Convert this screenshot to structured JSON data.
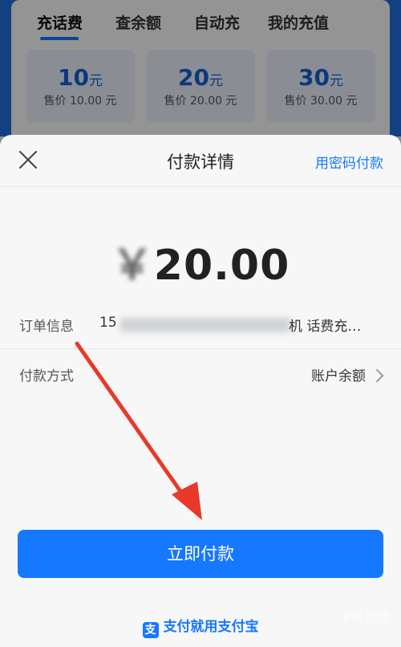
{
  "background": {
    "tabs": [
      "充话费",
      "查余额",
      "自动充",
      "我的充值"
    ],
    "prices": [
      {
        "amount": "10",
        "unit": "元",
        "sale": "售价 10.00 元"
      },
      {
        "amount": "20",
        "unit": "元",
        "sale": "售价 20.00 元"
      },
      {
        "amount": "30",
        "unit": "元",
        "sale": "售价 30.00 元"
      }
    ]
  },
  "sheet": {
    "title": "付款详情",
    "password_pay": "用密码付款",
    "amount_display": "20.00",
    "order_label": "订单信息",
    "order_prefix": "15",
    "order_suffix": "机 话费充…",
    "payment_method_label": "付款方式",
    "payment_method_value": "账户余额",
    "pay_button": "立即付款",
    "footer": "支付就用支付宝"
  },
  "colors": {
    "accent": "#1677ff",
    "arrow": "#e8392b"
  },
  "icons": [
    "close-icon",
    "chevron-right-icon",
    "alipay-logo-icon",
    "annotation-arrow"
  ]
}
